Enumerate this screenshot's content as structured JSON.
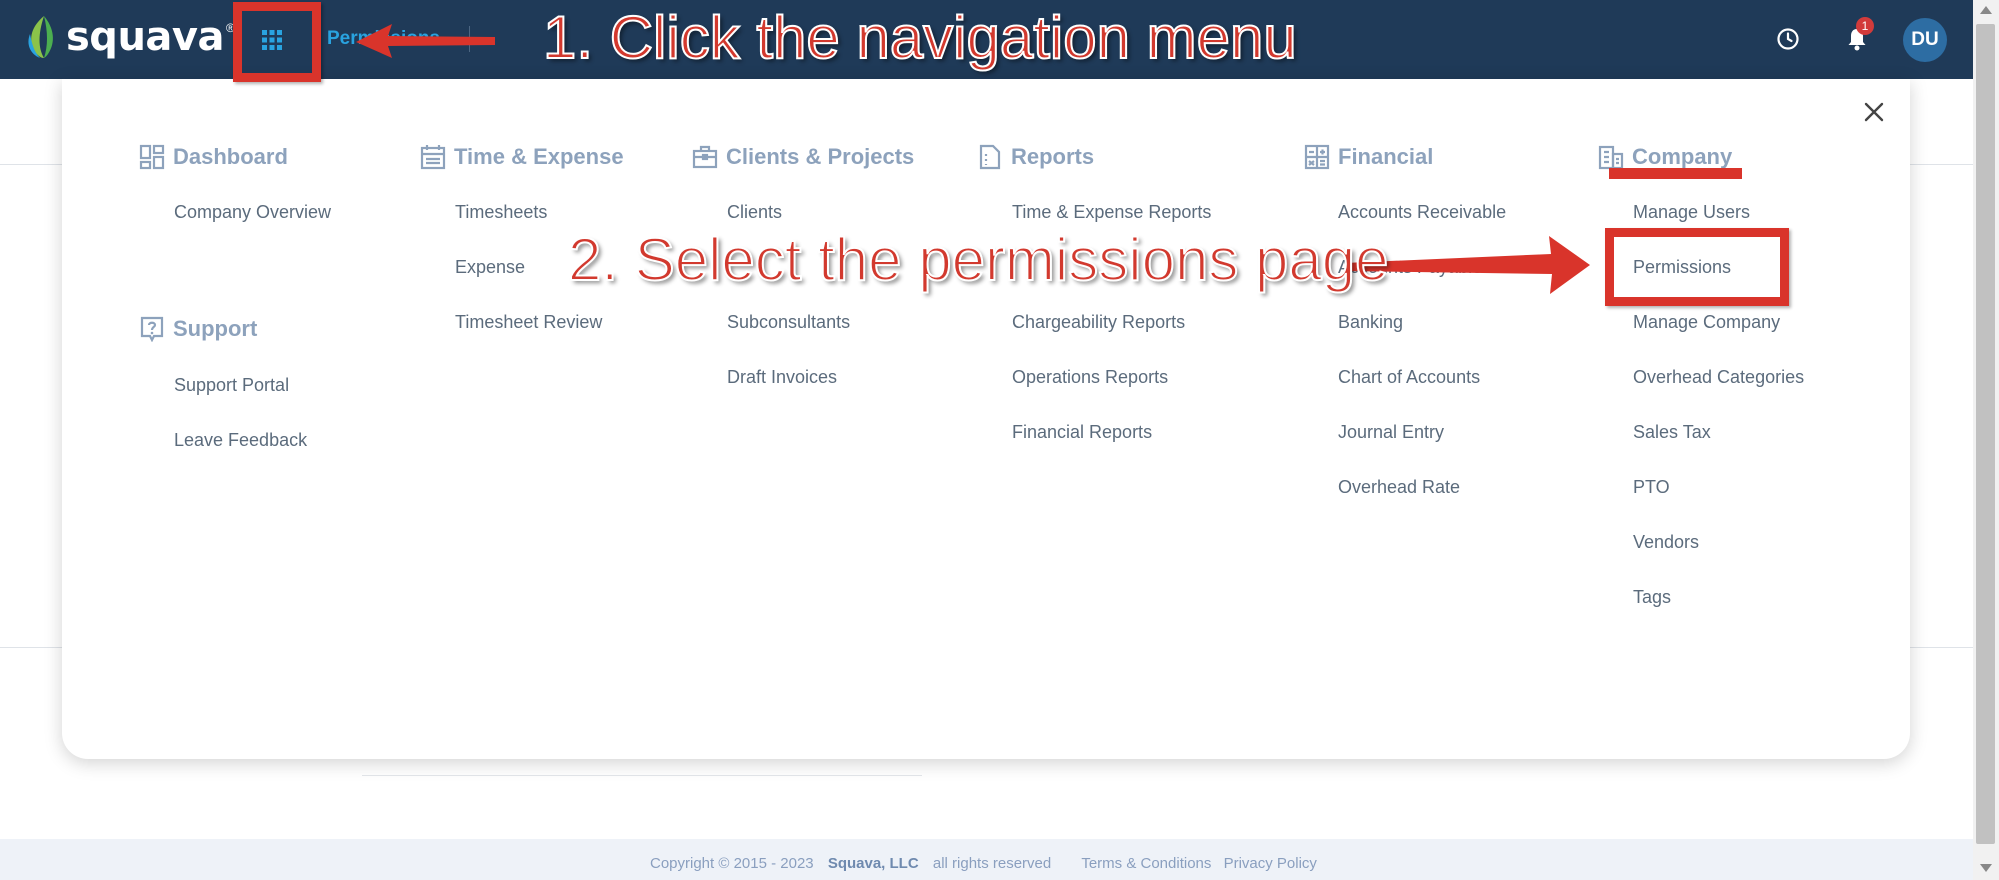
{
  "header": {
    "brand": "squava",
    "brand_mark": "®",
    "page_crumb": "Permissions",
    "notification_count": "1",
    "avatar_initials": "DU",
    "icons": [
      "squava-logo-icon",
      "grid-menu-icon",
      "clock-icon",
      "bell-icon"
    ]
  },
  "menu": {
    "columns": [
      {
        "heading": "Dashboard",
        "icon": "dashboard-icon",
        "items": [
          "Company Overview"
        ]
      },
      {
        "heading": "Support",
        "icon": "help-icon",
        "items": [
          "Support Portal",
          "Leave Feedback"
        ]
      },
      {
        "heading": "Time & Expense",
        "icon": "calendar-icon",
        "items": [
          "Timesheets",
          "Expense",
          "Timesheet Review"
        ]
      },
      {
        "heading": "Clients & Projects",
        "icon": "briefcase-icon",
        "items": [
          "Clients",
          "Subconsultants",
          "Draft Invoices"
        ]
      },
      {
        "heading": "Reports",
        "icon": "report-icon",
        "items": [
          "Time & Expense Reports",
          "Chargeability Reports",
          "Operations Reports",
          "Financial Reports"
        ]
      },
      {
        "heading": "Financial",
        "icon": "calculator-icon",
        "items": [
          "Accounts Receivable",
          "Accounts Payable",
          "Banking",
          "Chart of Accounts",
          "Journal Entry",
          "Overhead Rate"
        ]
      },
      {
        "heading": "Company",
        "icon": "building-icon",
        "items": [
          "Manage Users",
          "Permissions",
          "Manage Company",
          "Overhead Categories",
          "Sales Tax",
          "PTO",
          "Vendors",
          "Tags"
        ]
      }
    ],
    "close_icon": "close-icon"
  },
  "annotations": {
    "step1": "1. Click the navigation menu",
    "step2": "2. Select the permissions page",
    "color": "#d9342b"
  },
  "footer": {
    "copyright": "Copyright © 2015 - 2023",
    "company": "Squava, LLC",
    "rights": "all rights reserved",
    "terms": "Terms & Conditions",
    "privacy": "Privacy Policy"
  },
  "colors": {
    "topbar": "#1f3a58",
    "accent": "#29a3e0",
    "menu_heading": "#8da2bc",
    "menu_link": "#5b6b7c"
  }
}
